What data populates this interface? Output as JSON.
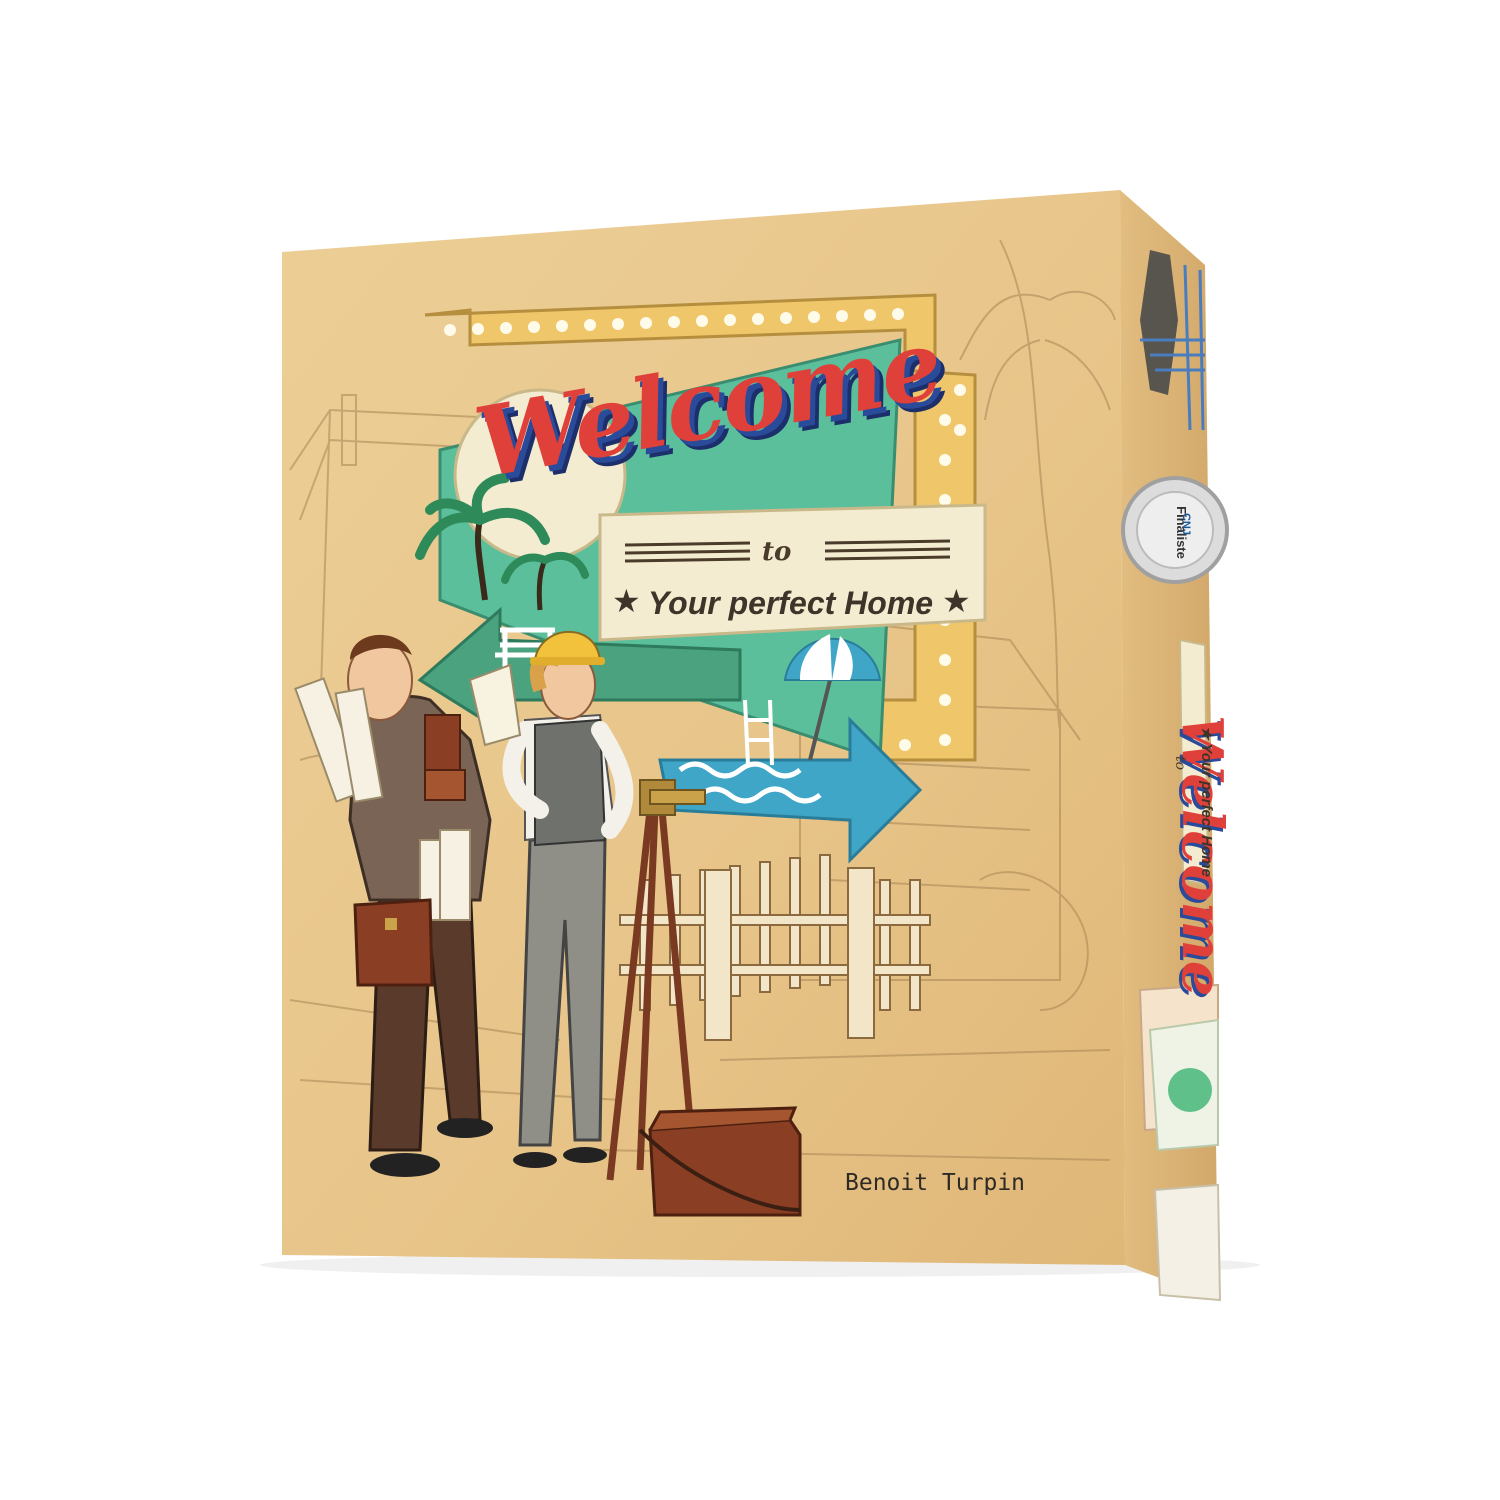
{
  "product": {
    "title_word": "Welcome",
    "title_to": "to",
    "subtitle": "Your perfect Home",
    "star_glyph": "★",
    "author": "Benoit Turpin"
  },
  "side_panel": {
    "title_word": "Welcome",
    "title_to": "to",
    "subtitle": "★ Your perfect Home"
  },
  "award_badge": {
    "label": "Finaliste",
    "logo_text": "CNJ"
  },
  "colors": {
    "box_cardboard": "#e9c98f",
    "sign_teal": "#5cbf9c",
    "title_red": "#e0403a",
    "title_shadow_blue": "#2a4a9a",
    "frame_gold": "#f0c66a",
    "cream": "#f4ecd0"
  }
}
